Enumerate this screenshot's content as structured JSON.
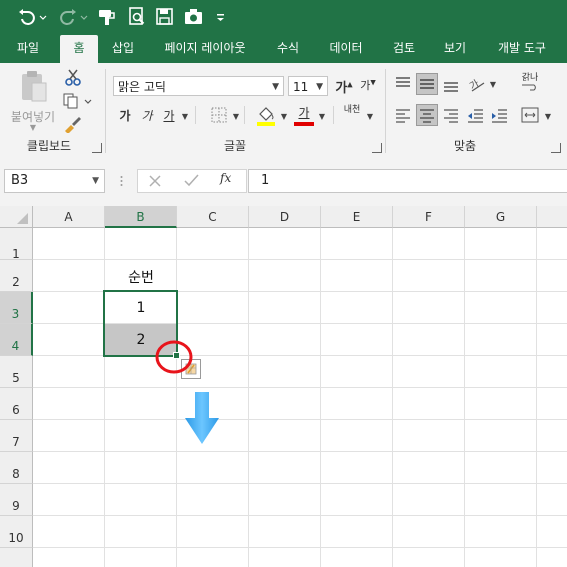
{
  "quick_access": {
    "icons": [
      "undo-icon",
      "redo-icon",
      "format-painter-icon",
      "print-preview-icon",
      "save-icon",
      "camera-icon",
      "customize-icon"
    ]
  },
  "tabs": [
    "파일",
    "홈",
    "삽입",
    "페이지 레이아웃",
    "수식",
    "데이터",
    "검토",
    "보기",
    "개발 도구"
  ],
  "active_tab": "홈",
  "ribbon": {
    "clipboard": {
      "paste_label": "붙여넣기",
      "group_label": "클립보드"
    },
    "font": {
      "font_name": "맑은 고딕",
      "font_size": "11",
      "grow_label": "가",
      "shrink_label": "가",
      "bold_label": "가",
      "italic_label": "가",
      "underline_label": "가",
      "font_color_label": "가",
      "phonetic_label": "내천",
      "group_label": "글꼴"
    },
    "alignment": {
      "wrap_label": "갉나",
      "group_label": "맞춤"
    },
    "colors": {
      "accent": "#217346",
      "highlight_yellow": "#ffff00",
      "font_red": "#e00000"
    }
  },
  "formula_bar": {
    "name_box": "B3",
    "fx_label": "fx",
    "value": "1"
  },
  "sheet": {
    "columns": [
      "A",
      "B",
      "C",
      "D",
      "E",
      "F",
      "G"
    ],
    "rows": [
      "1",
      "2",
      "3",
      "4",
      "5",
      "6",
      "7",
      "8",
      "9",
      "10"
    ],
    "selected_column": "B",
    "selected_rows": [
      "3",
      "4"
    ],
    "cells": {
      "B2": "순번",
      "B3": "1",
      "B4": "2"
    }
  },
  "annotation": {
    "circle_color": "#e8141b",
    "arrow_color": "#39a9ef"
  }
}
